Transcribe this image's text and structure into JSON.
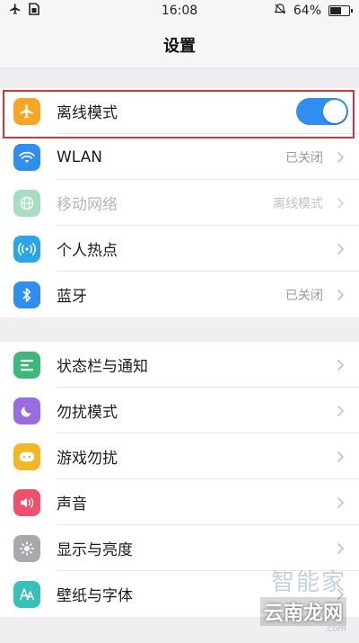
{
  "status_bar": {
    "time": "16:08",
    "battery": "64%",
    "battery_level": 0.64,
    "left_icons": [
      "airplane-icon",
      "sim-card-icon"
    ],
    "right_icons": [
      "alarm-off-icon",
      "battery-icon"
    ]
  },
  "header": {
    "title": "设置"
  },
  "group1": [
    {
      "id": "airplane",
      "label": "离线模式",
      "icon": "airplane-icon",
      "icon_color": "#f5a623",
      "control": "toggle",
      "toggle_on": true
    },
    {
      "id": "wlan",
      "label": "WLAN",
      "icon": "wifi-icon",
      "icon_color": "#2f8ef0",
      "value": "已关闭"
    },
    {
      "id": "mobile-network",
      "label": "移动网络",
      "icon": "globe-icon",
      "icon_color": "#3cb878",
      "value": "离线模式",
      "disabled": true
    },
    {
      "id": "hotspot",
      "label": "个人热点",
      "icon": "hotspot-icon",
      "icon_color": "#2aa6e8"
    },
    {
      "id": "bluetooth",
      "label": "蓝牙",
      "icon": "bluetooth-icon",
      "icon_color": "#2f8ef0",
      "value": "已关闭"
    }
  ],
  "group2": [
    {
      "id": "statusbar-notifications",
      "label": "状态栏与通知",
      "icon": "notification-list-icon",
      "icon_color": "#3cb878"
    },
    {
      "id": "dnd",
      "label": "勿扰模式",
      "icon": "moon-icon",
      "icon_color": "#9b6be0"
    },
    {
      "id": "game-dnd",
      "label": "游戏勿扰",
      "icon": "gamepad-icon",
      "icon_color": "#f5b623"
    },
    {
      "id": "sound",
      "label": "声音",
      "icon": "speaker-icon",
      "icon_color": "#f0506e"
    },
    {
      "id": "display",
      "label": "显示与亮度",
      "icon": "brightness-icon",
      "icon_color": "#a9a9ad"
    },
    {
      "id": "wallpaper",
      "label": "壁纸与字体",
      "icon": "font-icon",
      "icon_color": "#35c1b8"
    }
  ],
  "watermark": {
    "top": "智能家",
    "bottom": "云南龙网",
    "sub": ".com"
  }
}
